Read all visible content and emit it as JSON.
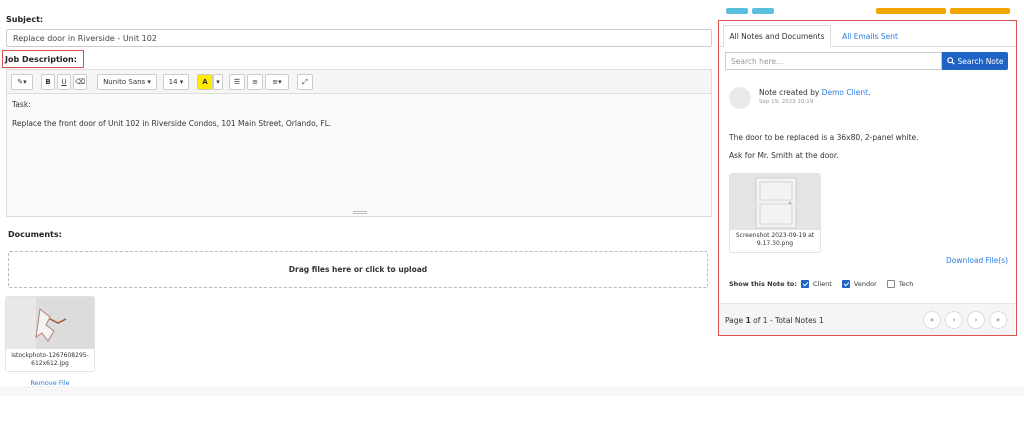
{
  "form": {
    "subject_label": "Subject:",
    "subject_value": "Replace door in Riverside - Unit 102",
    "job_description_label": "Job Description:",
    "documents_label": "Documents:"
  },
  "editor": {
    "toolbar": {
      "font_name": "Nunito Sans",
      "font_size": "14",
      "bold": "B",
      "underline": "U",
      "highlight": "A"
    },
    "body_lines": [
      "Task:",
      "Replace the front door of Unit 102 in Riverside Condos, 101 Main Street, Orlando, FL."
    ]
  },
  "upload": {
    "dropzone_text": "Drag files here or click to upload",
    "file_name": "istockphoto-1267608295-612x612.jpg",
    "remove_label": "Remove File"
  },
  "notes_panel": {
    "tabs": [
      "All Notes and Documents",
      "All Emails Sent"
    ],
    "search_placeholder": "Search here...",
    "search_button": "Search Note",
    "note": {
      "created_prefix": "Note created by",
      "author": "Demo Client",
      "author_suffix": ".",
      "date": "Sep 19, 2023 10:19",
      "line1": "The door to be replaced is a 36x80, 2-panel white.",
      "line2": "Ask for Mr. Smith at the door.",
      "attachment_name": "Screenshot 2023-09-19 at 9.17.30.png",
      "download_label": "Download File(s)",
      "show_label": "Show this Note to:",
      "visibility": [
        {
          "label": "Client",
          "checked": true
        },
        {
          "label": "Vendor",
          "checked": true
        },
        {
          "label": "Tech",
          "checked": false
        }
      ]
    },
    "pagination": {
      "page_prefix": "Page",
      "current": "1",
      "of_text": "of 1 - Total Notes 1",
      "buttons": [
        "«",
        "‹",
        "›",
        "»"
      ]
    }
  },
  "colors": {
    "accent_blue": "#1f63c6",
    "link_blue": "#2a7ae2",
    "highlight_red": "#d9534f",
    "top_blue": "#5bc0de",
    "top_orange": "#f0a500"
  }
}
